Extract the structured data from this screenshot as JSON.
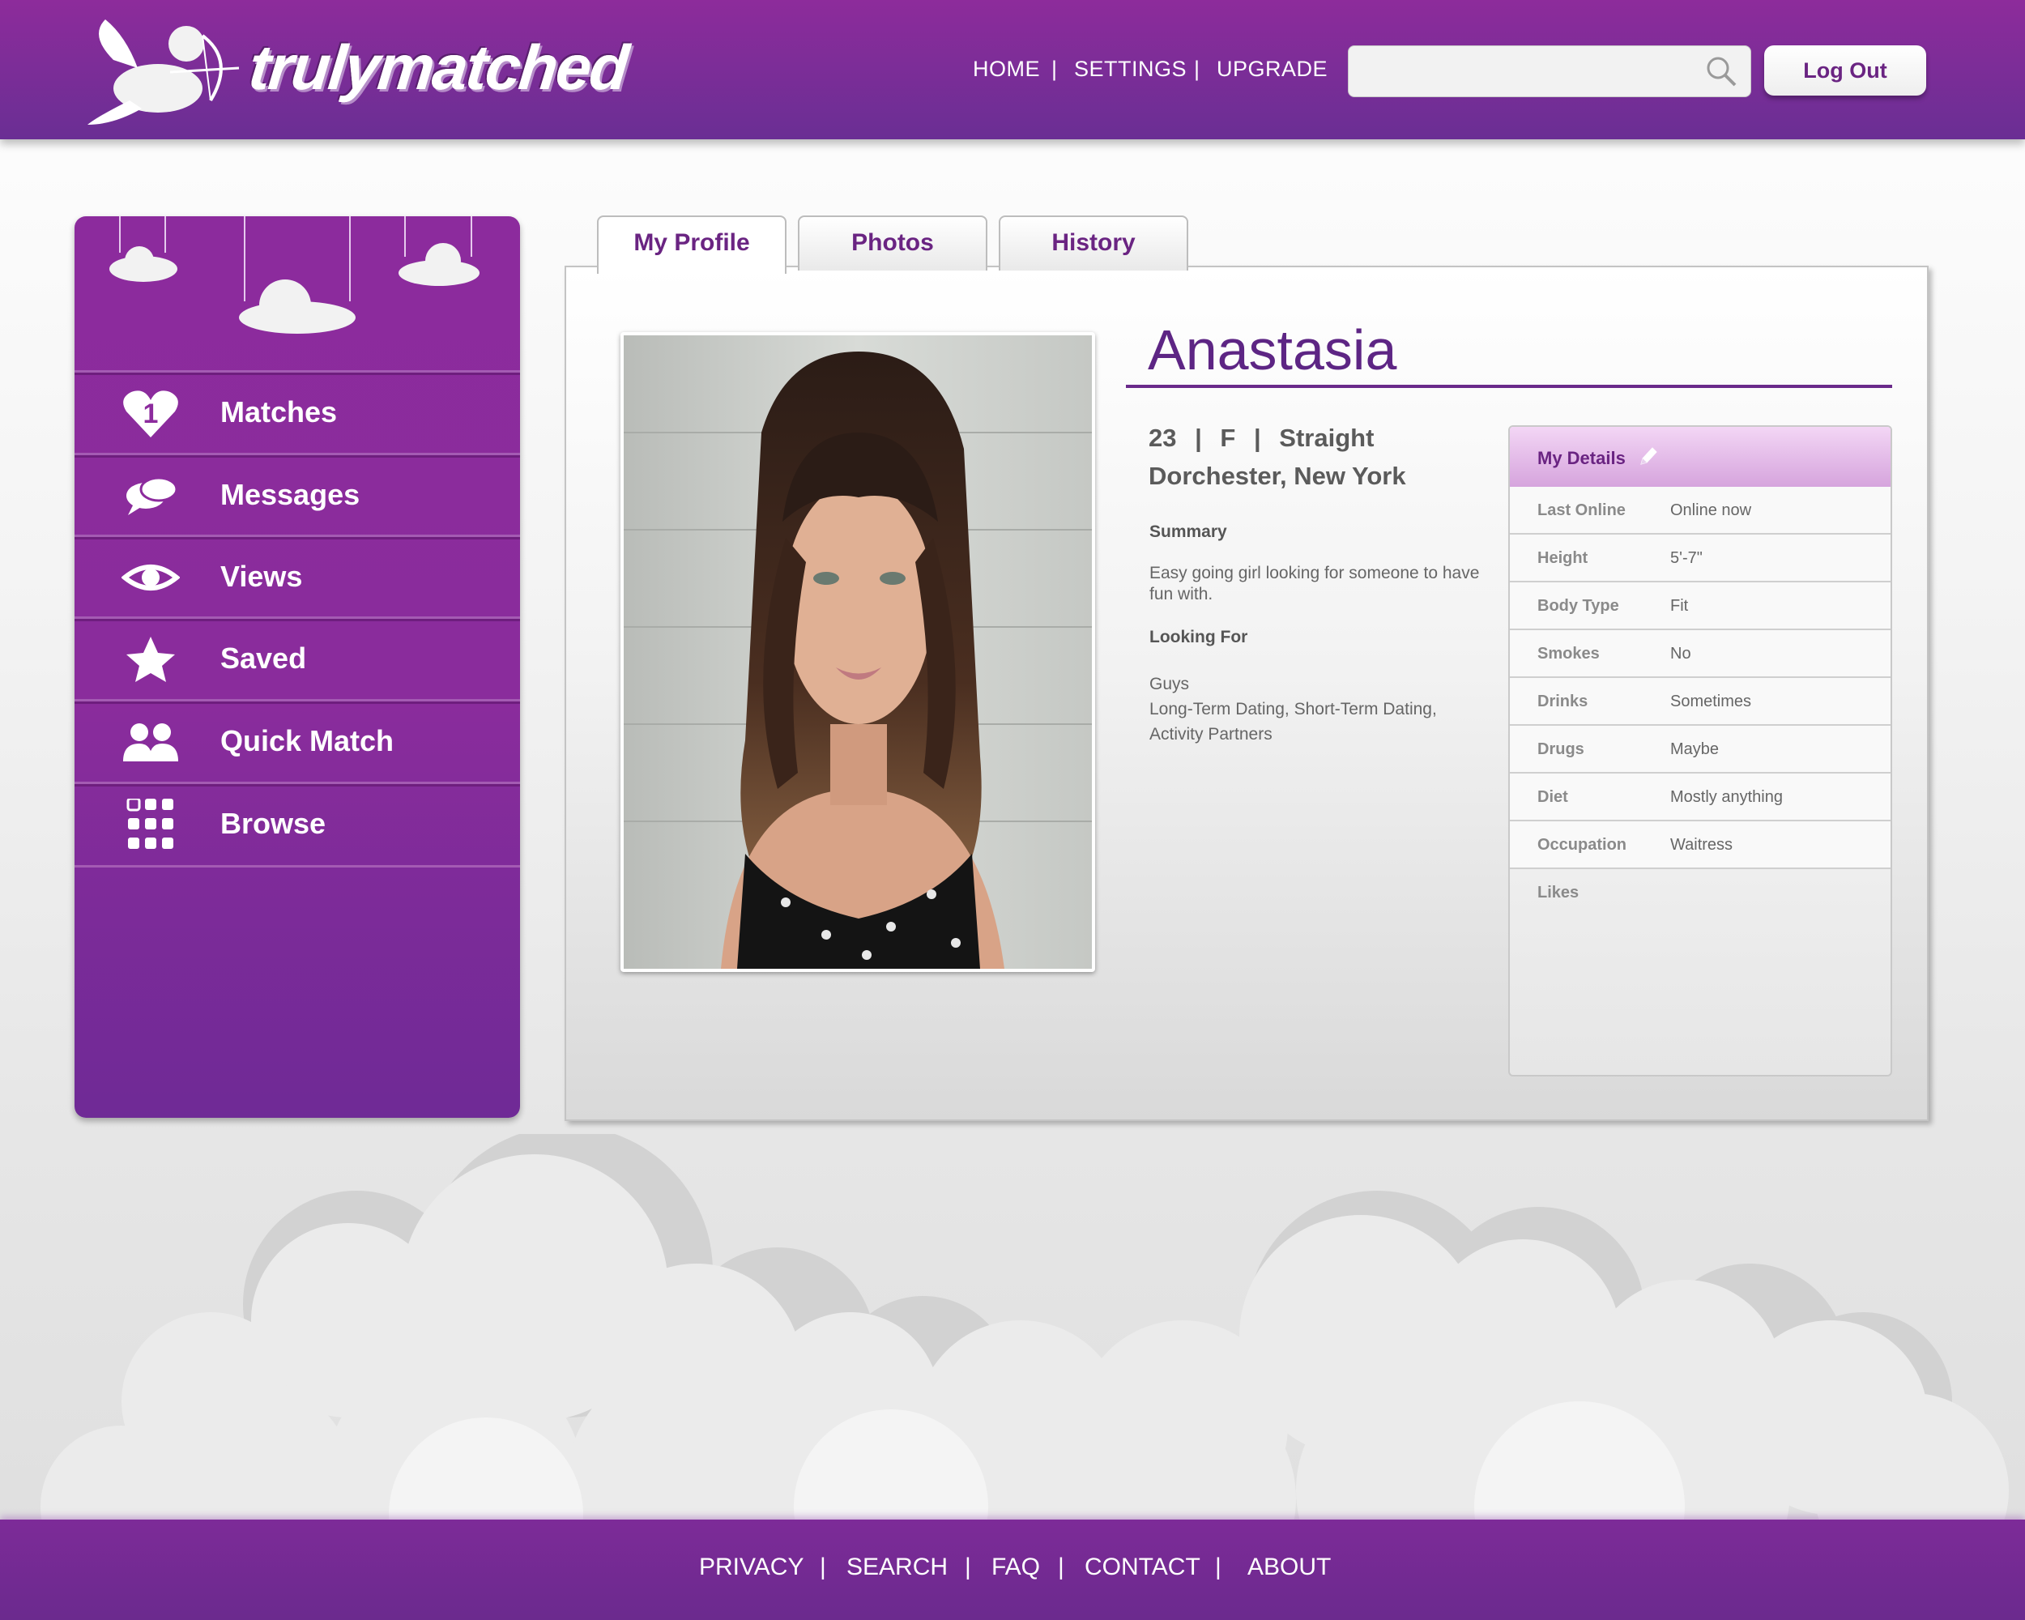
{
  "header": {
    "logo_text": "trulymatched",
    "nav": [
      "HOME",
      "SETTINGS",
      "UPGRADE"
    ],
    "separator": "|",
    "search": {
      "value": "",
      "placeholder": ""
    },
    "logout_label": "Log Out"
  },
  "sidebar": {
    "items": [
      {
        "label": "Matches",
        "icon": "heart-icon",
        "badge": "1"
      },
      {
        "label": "Messages",
        "icon": "speech-bubbles-icon"
      },
      {
        "label": "Views",
        "icon": "eye-icon"
      },
      {
        "label": "Saved",
        "icon": "star-icon"
      },
      {
        "label": "Quick Match",
        "icon": "people-icon"
      },
      {
        "label": "Browse",
        "icon": "grid-icon"
      }
    ]
  },
  "tabs": [
    "My Profile",
    "Photos",
    "History"
  ],
  "profile": {
    "name": "Anastasia",
    "age": "23",
    "gender": "F",
    "orientation": "Straight",
    "basic_sep": "|",
    "location": "Dorchester, New York",
    "summary_heading": "Summary",
    "summary_text": "Easy going girl looking for someone to have fun with.",
    "looking_heading": "Looking For",
    "looking_line1": "Guys",
    "looking_line2": "Long-Term Dating, Short-Term Dating, Activity Partners"
  },
  "details": {
    "title": "My Details",
    "rows": [
      {
        "label": "Last Online",
        "value": "Online now"
      },
      {
        "label": "Height",
        "value": "5'-7\""
      },
      {
        "label": "Body Type",
        "value": "Fit"
      },
      {
        "label": "Smokes",
        "value": "No"
      },
      {
        "label": "Drinks",
        "value": "Sometimes"
      },
      {
        "label": "Drugs",
        "value": "Maybe"
      },
      {
        "label": "Diet",
        "value": "Mostly anything"
      },
      {
        "label": "Occupation",
        "value": "Waitress"
      },
      {
        "label": "Likes",
        "value": ""
      }
    ]
  },
  "footer": {
    "links": [
      "PRIVACY",
      "SEARCH",
      "FAQ",
      "CONTACT",
      "ABOUT"
    ],
    "separator": "|"
  },
  "colors": {
    "brand_purple": "#8d2c9b",
    "deep_purple": "#6a2482",
    "name_purple": "#5d2584"
  }
}
